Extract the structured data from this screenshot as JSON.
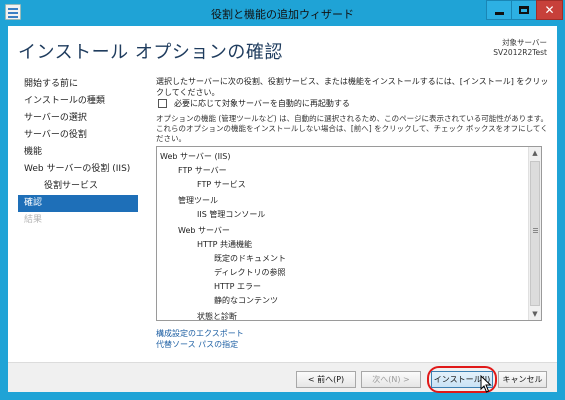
{
  "window": {
    "title": "役割と機能の追加ウィザード"
  },
  "header": {
    "title": "インストール オプションの確認",
    "target_label": "対象サーバー",
    "target_value": "SV2012R2Test"
  },
  "nav": {
    "items": [
      {
        "label": "開始する前に",
        "state": "normal"
      },
      {
        "label": "インストールの種類",
        "state": "normal"
      },
      {
        "label": "サーバーの選択",
        "state": "normal"
      },
      {
        "label": "サーバーの役割",
        "state": "normal"
      },
      {
        "label": "機能",
        "state": "normal"
      },
      {
        "label": "Web サーバーの役割 (IIS)",
        "state": "normal"
      },
      {
        "label": "役割サービス",
        "state": "sub"
      },
      {
        "label": "確認",
        "state": "active"
      },
      {
        "label": "結果",
        "state": "disabled"
      }
    ]
  },
  "content": {
    "lead": "選択したサーバーに次の役割、役割サービス、または機能をインストールするには、[インストール] をクリックしてください。",
    "restart_label": "必要に応じて対象サーバーを自動的に再起動する",
    "note": "オプションの機能 (管理ツールなど) は、自動的に選択されるため、このページに表示されている可能性があります。これらのオプションの機能をインストールしない場合は、[前へ] をクリックして、チェック ボックスをオフにしてください。",
    "tree": [
      {
        "label": "Web サーバー (IIS)",
        "level": 0
      },
      {
        "label": "FTP サーバー",
        "level": 1
      },
      {
        "label": "FTP サービス",
        "level": 2
      },
      {
        "label": "管理ツール",
        "level": 1
      },
      {
        "label": "IIS 管理コンソール",
        "level": 2
      },
      {
        "label": "Web サーバー",
        "level": 1
      },
      {
        "label": "HTTP 共通機能",
        "level": 2
      },
      {
        "label": "既定のドキュメント",
        "level": 3
      },
      {
        "label": "ディレクトリの参照",
        "level": 3
      },
      {
        "label": "HTTP エラー",
        "level": 3
      },
      {
        "label": "静的なコンテンツ",
        "level": 3
      },
      {
        "label": "状態と診断",
        "level": 2
      }
    ],
    "export_link": "構成設定のエクスポート",
    "source_link": "代替ソース パスの指定"
  },
  "footer": {
    "prev_label": "< 前へ(P)",
    "next_label": "次へ(N) >",
    "install_label": "インストール(I)",
    "cancel_label": "キャンセル"
  }
}
